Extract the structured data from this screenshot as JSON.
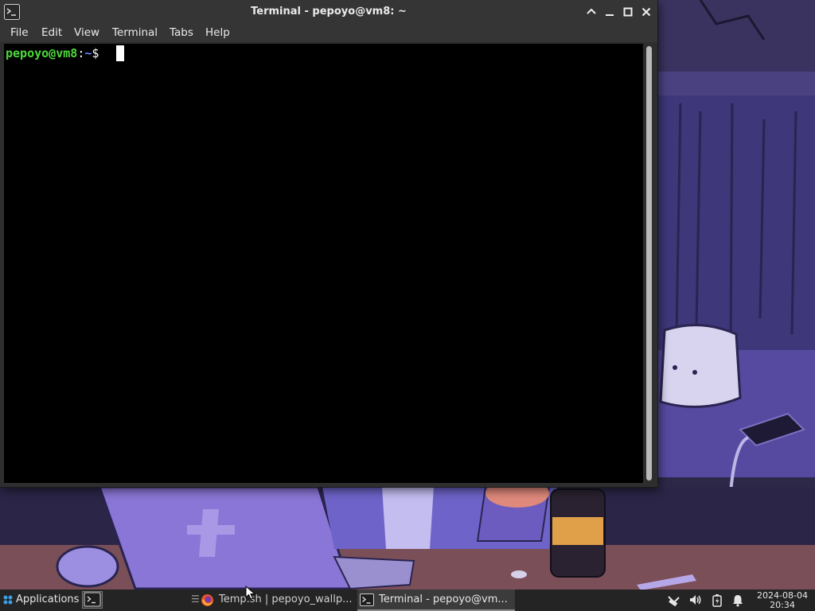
{
  "window": {
    "title": "Terminal - pepoyo@vm8: ~",
    "menu": [
      "File",
      "Edit",
      "View",
      "Terminal",
      "Tabs",
      "Help"
    ]
  },
  "terminal": {
    "user_host": "pepoyo@vm8",
    "colon": ":",
    "path": "~",
    "dollar": "$"
  },
  "taskbar": {
    "applications_label": "Applications",
    "tasks": [
      {
        "label": "Temp.sh | pepoyo_wallp...",
        "icon": "firefox-icon"
      },
      {
        "label": "Terminal - pepoyo@vm...",
        "icon": "terminal-icon"
      }
    ],
    "clock_date": "2024-08-04",
    "clock_time": "20:34"
  },
  "colors": {
    "titlebar": "#353535",
    "terminal_bg": "#000000",
    "prompt_user": "#4dd93b",
    "prompt_path": "#5f87ff",
    "taskbar": "#242424",
    "wallpaper_purple": "#5b4fa6"
  }
}
